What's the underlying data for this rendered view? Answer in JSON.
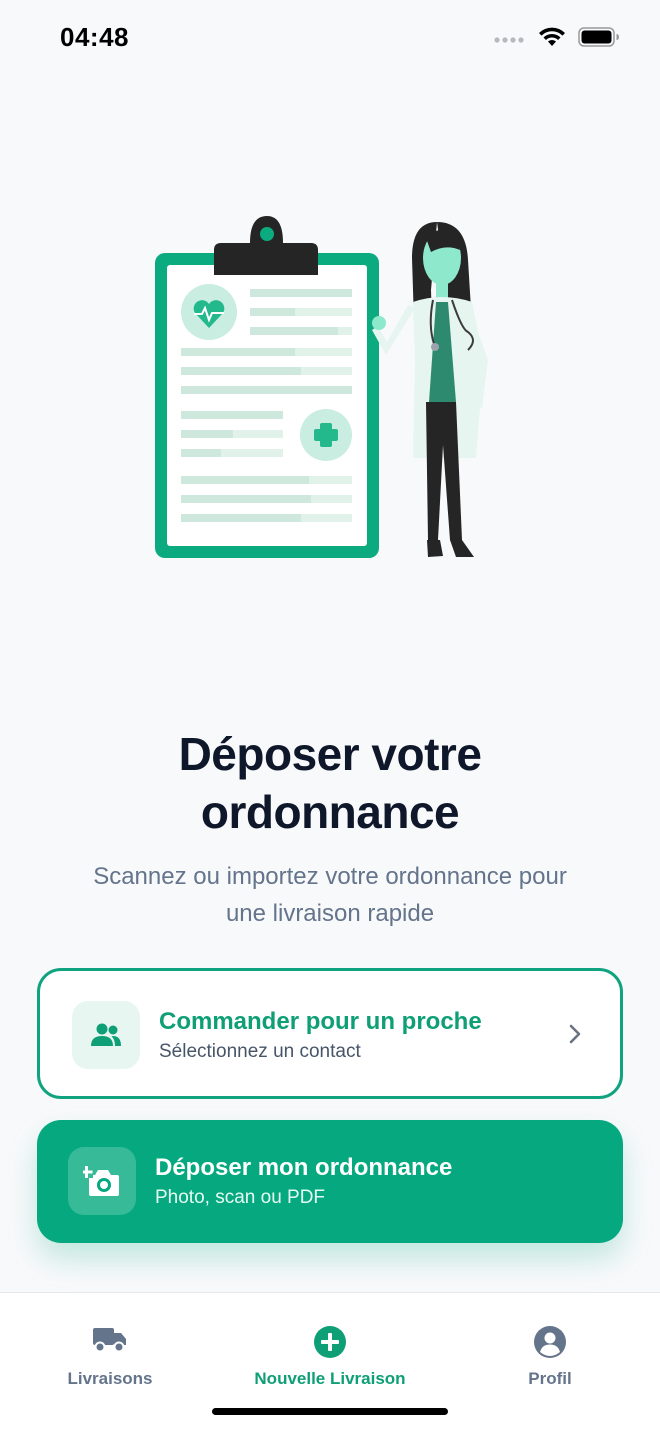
{
  "status": {
    "time": "04:48"
  },
  "hero": {
    "title_line1": "Déposer votre",
    "title_line2": "ordonnance",
    "subtitle_line1": "Scannez ou importez votre ordonnance pour",
    "subtitle_line2": "une livraison rapide"
  },
  "actions": {
    "proche": {
      "title": "Commander pour un proche",
      "subtitle": "Sélectionnez un contact",
      "icon": "users-icon"
    },
    "upload": {
      "title": "Déposer mon ordonnance",
      "subtitle": "Photo, scan ou PDF",
      "icon": "add-photo-icon"
    }
  },
  "tabs": [
    {
      "label": "Livraisons",
      "icon": "truck-icon"
    },
    {
      "label": "Nouvelle Livraison",
      "icon": "plus-circle-icon"
    },
    {
      "label": "Profil",
      "icon": "user-circle-icon"
    }
  ],
  "colors": {
    "accent": "#06a97f",
    "accent_dark": "#0e9f76",
    "text": "#0f172a",
    "muted": "#64748b",
    "background": "#f8f9fb"
  }
}
